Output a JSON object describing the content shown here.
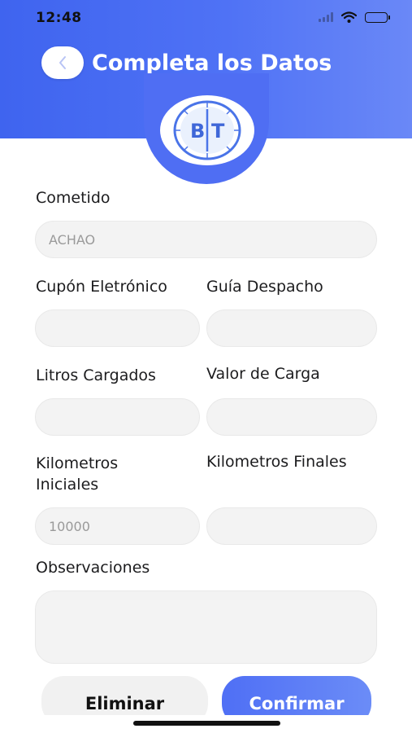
{
  "status_bar": {
    "time": "12:48"
  },
  "header": {
    "title": "Completa los Datos"
  },
  "logo": {
    "letter_left": "B",
    "letter_right": "T"
  },
  "form": {
    "cometido": {
      "label": "Cometido",
      "value": "ACHAO"
    },
    "cupon": {
      "label": "Cupón Eletrónico",
      "value": ""
    },
    "guia": {
      "label": "Guía Despacho",
      "value": ""
    },
    "litros": {
      "label": "Litros Cargados",
      "value": ""
    },
    "valor": {
      "label": "Valor de Carga",
      "value": ""
    },
    "km_iniciales": {
      "label_line1": "Kilometros",
      "label_line2": "Iniciales",
      "value": "10000"
    },
    "km_finales": {
      "label": "Kilometros Finales",
      "value": ""
    },
    "observaciones": {
      "label": "Observaciones",
      "value": ""
    }
  },
  "actions": {
    "eliminar_label": "Eliminar",
    "confirmar_label": "Confirmar"
  },
  "colors": {
    "accent": "#4f6ef3",
    "field_bg": "#f3f3f3",
    "title_text": "#ffffff"
  }
}
